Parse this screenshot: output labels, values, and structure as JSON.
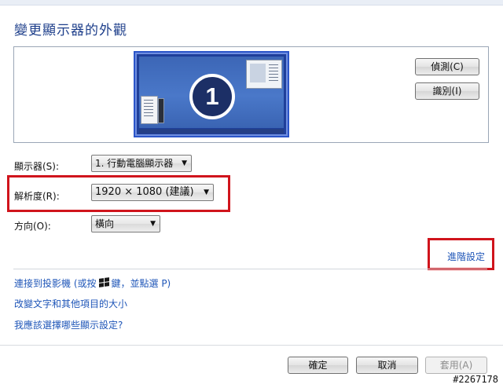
{
  "title": "變更顯示器的外觀",
  "preview": {
    "monitor_number": "1",
    "detect_button": "偵測(C)",
    "identify_button": "識別(I)"
  },
  "settings": {
    "display_label": "顯示器(S):",
    "display_value": "1. 行動電腦顯示器",
    "resolution_label": "解析度(R):",
    "resolution_value": "1920 × 1080 (建議)",
    "orientation_label": "方向(O):",
    "orientation_value": "橫向"
  },
  "advanced_link": "進階設定",
  "links": {
    "projector_prefix": "連接到投影機 (或按",
    "projector_suffix": "鍵，並點選 P)",
    "text_size": "改變文字和其他項目的大小",
    "which_settings": "我應該選擇哪些顯示設定?"
  },
  "footer": {
    "ok": "確定",
    "cancel": "取消",
    "apply": "套用(A)"
  },
  "watermark": "#2267178",
  "colors": {
    "title": "#1e3f8b",
    "link": "#1f56b8",
    "highlight": "#d0141c",
    "monitor": "#1f3f9a"
  },
  "icons": {
    "windows_key": "windows-logo-icon",
    "dropdown": "triangle-down-icon"
  }
}
